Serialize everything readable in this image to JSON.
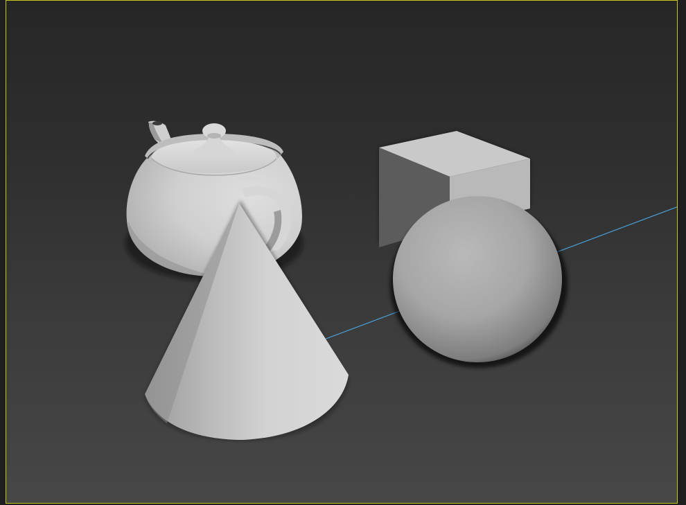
{
  "viewport": {
    "state": "active",
    "shading": "default-shading",
    "border_color": "#c8c820",
    "background_top": "#262626",
    "background_bottom": "#474747",
    "grid_axis_color": "#4aa3df"
  },
  "scene_objects": [
    {
      "name": "teapot",
      "kind": "Teapot"
    },
    {
      "name": "cone",
      "kind": "Cone"
    },
    {
      "name": "box",
      "kind": "Box"
    },
    {
      "name": "sphere",
      "kind": "Sphere"
    }
  ],
  "material_color": "#c8c8c8"
}
